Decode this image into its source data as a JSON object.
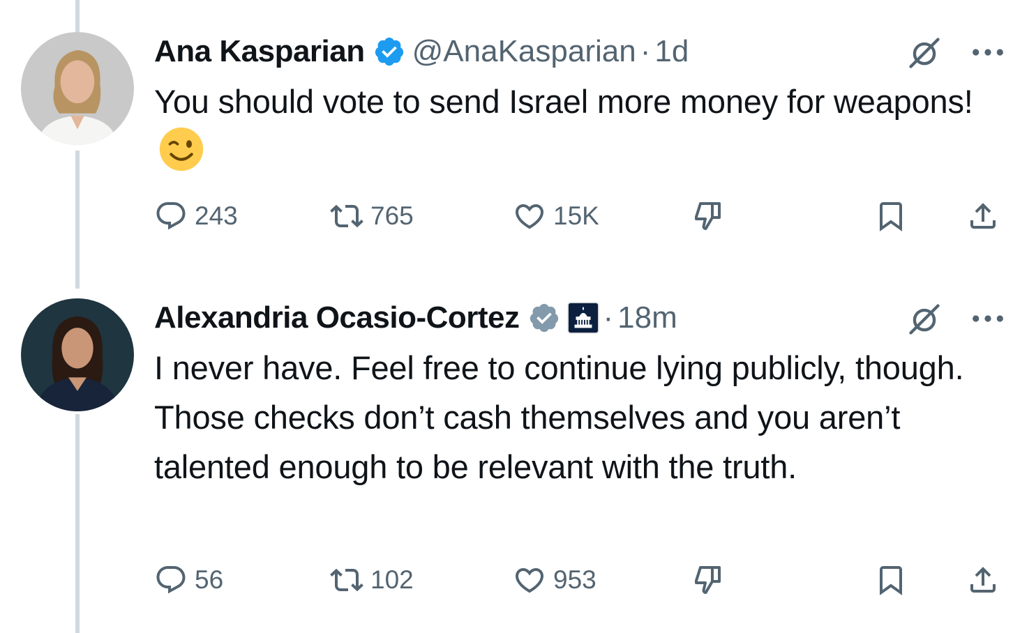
{
  "tweets": [
    {
      "name": "Ana Kasparian",
      "handle": "@AnaKasparian",
      "separator": "·",
      "time": "1d",
      "text": "You should vote to send Israel more money for weapons!",
      "emoji": "winking-face-emoji",
      "verified_color": "#1d9bf0",
      "counts": {
        "replies": "243",
        "retweets": "765",
        "likes": "15K"
      }
    },
    {
      "name": "Alexandria Ocasio-Cortez",
      "separator": "·",
      "time": "18m",
      "text": "I never have. Feel free to continue lying publicly, though. Those checks don’t cash themselves and you aren’t talented enough to be relevant with the truth.",
      "verified_color": "#829aab",
      "affiliation_icon": "us-capitol-icon",
      "counts": {
        "replies": "56",
        "retweets": "102",
        "likes": "953"
      }
    }
  ],
  "colors": {
    "text": "#0f1419",
    "secondary": "#536471",
    "thread_line": "#cfd9de"
  }
}
